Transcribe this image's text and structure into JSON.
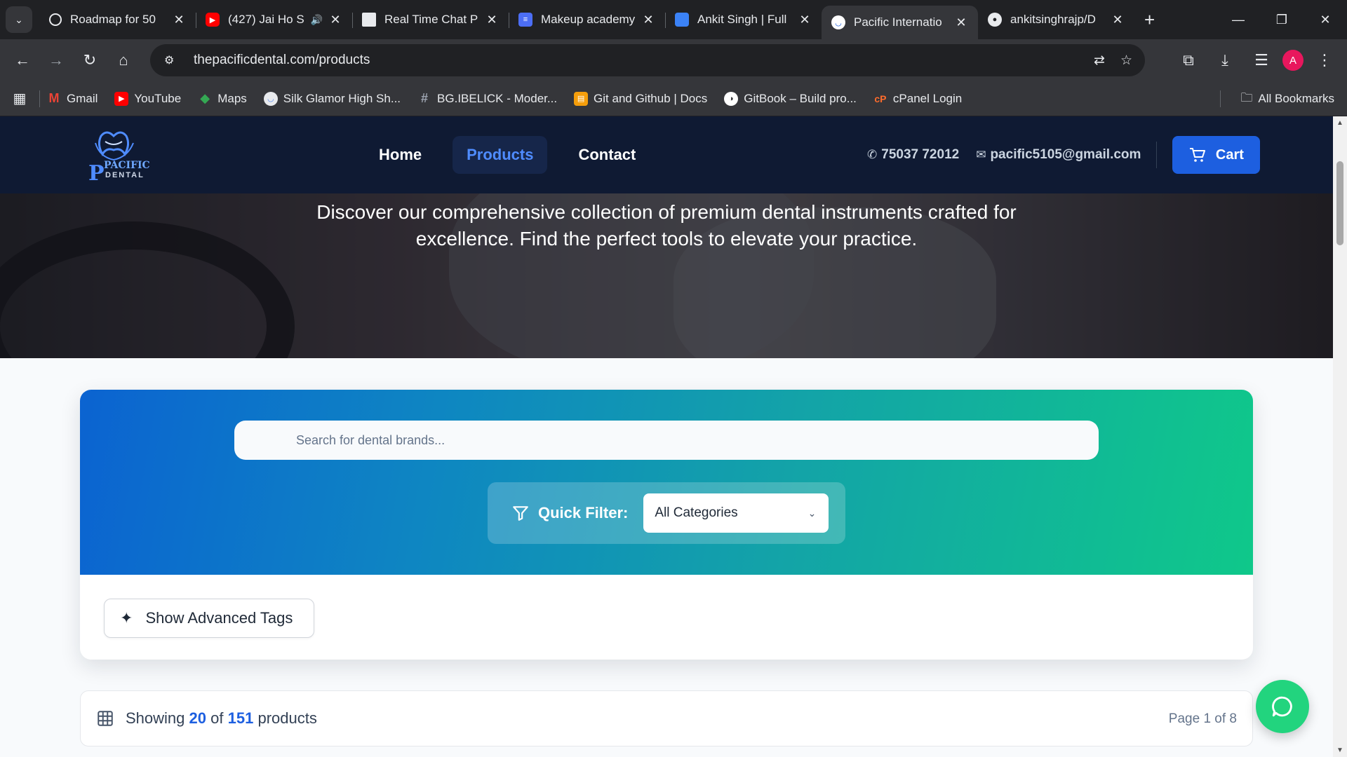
{
  "browser": {
    "tabs": [
      {
        "title": "Roadmap for 50",
        "favicon": "openai-icon",
        "color": "#202124"
      },
      {
        "title": "(427) Jai Ho S",
        "favicon": "youtube-icon",
        "color": "#ff0000",
        "audio": true
      },
      {
        "title": "Real Time Chat P",
        "favicon": "app-icon",
        "color": "#3c4043"
      },
      {
        "title": "Makeup academy",
        "favicon": "forms-icon",
        "color": "#1a73e8"
      },
      {
        "title": "Ankit Singh | Full",
        "favicon": "briefcase-icon",
        "color": "#4285f4"
      },
      {
        "title": "Pacific Internatio",
        "favicon": "tooth-icon",
        "color": "#ffffff",
        "active": true
      },
      {
        "title": "ankitsinghrajp/D",
        "favicon": "github-icon",
        "color": "#202124"
      }
    ],
    "url": "thepacificdental.com/products",
    "avatar_letter": "A",
    "bookmarks": [
      {
        "label": "Gmail",
        "icon": "gmail-icon",
        "color": "#ea4335"
      },
      {
        "label": "YouTube",
        "icon": "youtube-icon",
        "color": "#ff0000"
      },
      {
        "label": "Maps",
        "icon": "maps-icon",
        "color": "#34a853"
      },
      {
        "label": "Silk Glamor High Sh...",
        "icon": "silk-icon",
        "color": "#5b8def"
      },
      {
        "label": "BG.IBELICK - Moder...",
        "icon": "hash-icon",
        "color": "#6b7280"
      },
      {
        "label": "Git and Github | Docs",
        "icon": "doc-icon",
        "color": "#f59e0b"
      },
      {
        "label": "GitBook – Build pro...",
        "icon": "gitbook-icon",
        "color": "#ffffff"
      },
      {
        "label": "cPanel Login",
        "icon": "cpanel-icon",
        "color": "#ff6c2c"
      }
    ],
    "all_bookmarks": "All Bookmarks"
  },
  "site": {
    "logo_name": "PACIFIC",
    "logo_sub": "DENTAL",
    "logo_letter": "P",
    "nav": [
      {
        "label": "Home",
        "active": false
      },
      {
        "label": "Products",
        "active": true
      },
      {
        "label": "Contact",
        "active": false
      }
    ],
    "phone": "75037 72012",
    "email": "pacific5105@gmail.com",
    "cart_label": "Cart",
    "accent": "#1d5fe0"
  },
  "hero": {
    "text": "Discover our comprehensive collection of premium dental instruments crafted for excellence. Find the perfect tools to elevate your practice."
  },
  "search": {
    "placeholder": "Search for dental brands...",
    "quick_filter_label": "Quick Filter:",
    "category_selected": "All Categories",
    "advanced_tags_label": "Show Advanced Tags"
  },
  "results": {
    "prefix": "Showing",
    "shown": "20",
    "of": "of",
    "total": "151",
    "suffix": "products",
    "page_info": "Page 1 of 8"
  }
}
